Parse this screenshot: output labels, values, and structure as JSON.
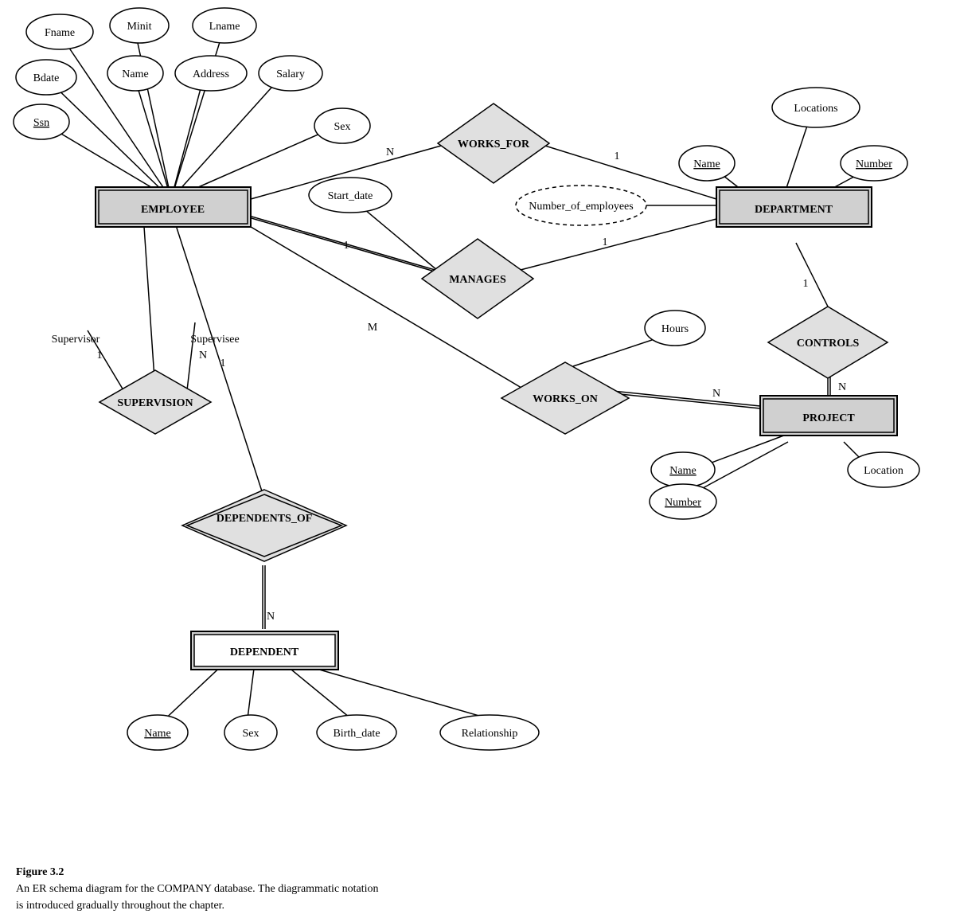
{
  "caption": {
    "title": "Figure 3.2",
    "line1": "An ER schema diagram for the COMPANY database. The diagrammatic notation",
    "line2": "is introduced gradually throughout the chapter."
  },
  "entities": {
    "employee": "EMPLOYEE",
    "department": "DEPARTMENT",
    "project": "PROJECT",
    "dependent": "DEPENDENT"
  },
  "relationships": {
    "works_for": "WORKS_FOR",
    "manages": "MANAGES",
    "works_on": "WORKS_ON",
    "controls": "CONTROLS",
    "supervision": "SUPERVISION",
    "dependents_of": "DEPENDENTS_OF"
  },
  "attributes": {
    "fname": "Fname",
    "minit": "Minit",
    "lname": "Lname",
    "bdate": "Bdate",
    "name_emp": "Name",
    "address": "Address",
    "salary": "Salary",
    "ssn": "Ssn",
    "sex_emp": "Sex",
    "start_date": "Start_date",
    "num_employees": "Number_of_employees",
    "locations": "Locations",
    "dept_name": "Name",
    "dept_number": "Number",
    "hours": "Hours",
    "proj_name": "Name",
    "proj_number": "Number",
    "location": "Location",
    "dep_name": "Name",
    "dep_sex": "Sex",
    "birth_date": "Birth_date",
    "relationship": "Relationship"
  }
}
